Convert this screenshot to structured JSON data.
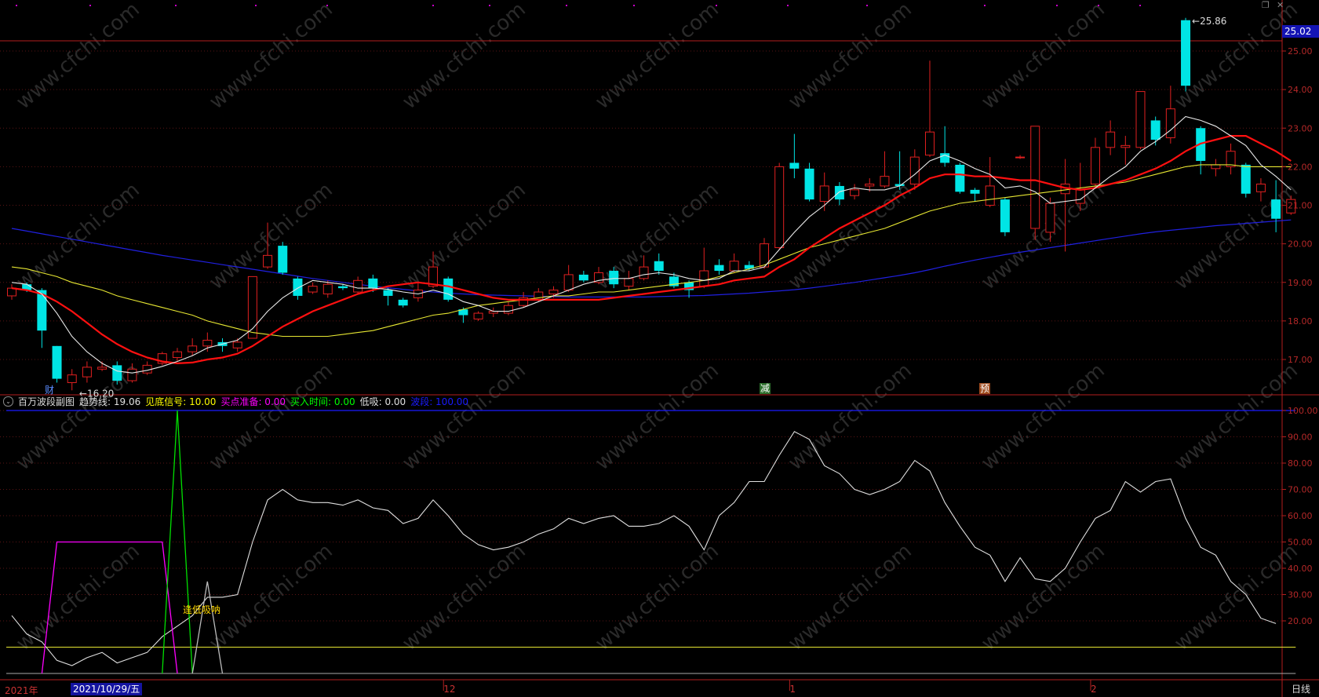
{
  "price_panel": {
    "price_tag": "25.02",
    "high_label": "25.86",
    "low_label": "16.20",
    "y_ticks": [
      "25.00",
      "24.00",
      "23.00",
      "22.00",
      "21.00",
      "20.00",
      "19.00",
      "18.00",
      "17.00"
    ],
    "event_marks": [
      "财",
      "减",
      "预"
    ]
  },
  "indicator": {
    "name": "百万波段副图",
    "fields": [
      {
        "label": "趋势线:",
        "value": "19.06",
        "color": "#e0e0e0"
      },
      {
        "label": "见底信号:",
        "value": "10.00",
        "color": "#ffff00"
      },
      {
        "label": "买点准备:",
        "value": "0.00",
        "color": "#ff00ff"
      },
      {
        "label": "买入时间:",
        "value": "0.00",
        "color": "#00ff00"
      },
      {
        "label": "低吸:",
        "value": "0.00",
        "color": "#e0e0e0"
      },
      {
        "label": "波段:",
        "value": "100.00",
        "color": "#1a1aff"
      }
    ],
    "annotation": "逢低吸呐",
    "y_ticks": [
      "100.00",
      "90.00",
      "80.00",
      "70.00",
      "60.00",
      "50.00",
      "40.00",
      "30.00",
      "20.00"
    ]
  },
  "x_axis": {
    "labels": [
      "2021年",
      "12",
      "1",
      "2"
    ],
    "cursor_date": "2021/10/29/五",
    "period": "日线"
  },
  "watermark": "www.cfchi.com",
  "colors": {
    "up": "#e02020",
    "down": "#00e5e5",
    "ma5": "#e8e8e8",
    "ma10": "#ff1010",
    "ma20": "#e6e632",
    "ma60": "#2020e0",
    "axis": "#b41e1e"
  },
  "chart_data": {
    "type": "candlestick",
    "candles": [
      {
        "o": 18.65,
        "c": 18.85,
        "h": 18.95,
        "l": 18.55
      },
      {
        "o": 18.95,
        "c": 18.8,
        "h": 19.0,
        "l": 18.75
      },
      {
        "o": 18.8,
        "c": 17.75,
        "h": 18.85,
        "l": 17.3
      },
      {
        "o": 17.35,
        "c": 16.5,
        "h": 17.35,
        "l": 16.4
      },
      {
        "o": 16.4,
        "c": 16.6,
        "h": 16.75,
        "l": 16.2
      },
      {
        "o": 16.55,
        "c": 16.8,
        "h": 16.95,
        "l": 16.4
      },
      {
        "o": 16.75,
        "c": 16.8,
        "h": 16.95,
        "l": 16.7
      },
      {
        "o": 16.85,
        "c": 16.45,
        "h": 16.95,
        "l": 16.35
      },
      {
        "o": 16.45,
        "c": 16.75,
        "h": 16.9,
        "l": 16.4
      },
      {
        "o": 16.65,
        "c": 16.85,
        "h": 16.95,
        "l": 16.6
      },
      {
        "o": 16.9,
        "c": 17.15,
        "h": 17.2,
        "l": 16.85
      },
      {
        "o": 17.05,
        "c": 17.2,
        "h": 17.3,
        "l": 16.95
      },
      {
        "o": 17.2,
        "c": 17.35,
        "h": 17.55,
        "l": 17.1
      },
      {
        "o": 17.35,
        "c": 17.5,
        "h": 17.7,
        "l": 17.2
      },
      {
        "o": 17.45,
        "c": 17.35,
        "h": 17.55,
        "l": 17.2
      },
      {
        "o": 17.3,
        "c": 17.45,
        "h": 17.55,
        "l": 17.2
      },
      {
        "o": 17.55,
        "c": 19.15,
        "h": 19.15,
        "l": 17.55
      },
      {
        "o": 19.4,
        "c": 19.7,
        "h": 20.55,
        "l": 19.35
      },
      {
        "o": 19.95,
        "c": 19.25,
        "h": 20.05,
        "l": 19.2
      },
      {
        "o": 19.1,
        "c": 18.65,
        "h": 19.15,
        "l": 18.55
      },
      {
        "o": 18.75,
        "c": 18.9,
        "h": 19.0,
        "l": 18.7
      },
      {
        "o": 18.7,
        "c": 18.95,
        "h": 19.05,
        "l": 18.6
      },
      {
        "o": 18.9,
        "c": 18.85,
        "h": 18.95,
        "l": 18.8
      },
      {
        "o": 18.75,
        "c": 19.05,
        "h": 19.15,
        "l": 18.7
      },
      {
        "o": 19.1,
        "c": 18.85,
        "h": 19.2,
        "l": 18.75
      },
      {
        "o": 18.8,
        "c": 18.65,
        "h": 18.85,
        "l": 18.4
      },
      {
        "o": 18.55,
        "c": 18.4,
        "h": 18.6,
        "l": 18.35
      },
      {
        "o": 18.6,
        "c": 18.8,
        "h": 19.0,
        "l": 18.5
      },
      {
        "o": 18.9,
        "c": 19.4,
        "h": 19.8,
        "l": 18.85
      },
      {
        "o": 19.1,
        "c": 18.55,
        "h": 19.15,
        "l": 18.5
      },
      {
        "o": 18.3,
        "c": 18.15,
        "h": 18.35,
        "l": 17.95
      },
      {
        "o": 18.05,
        "c": 18.2,
        "h": 18.25,
        "l": 18.0
      },
      {
        "o": 18.2,
        "c": 18.25,
        "h": 18.35,
        "l": 18.1
      },
      {
        "o": 18.2,
        "c": 18.4,
        "h": 18.5,
        "l": 18.15
      },
      {
        "o": 18.4,
        "c": 18.6,
        "h": 18.75,
        "l": 18.35
      },
      {
        "o": 18.55,
        "c": 18.75,
        "h": 18.85,
        "l": 18.5
      },
      {
        "o": 18.7,
        "c": 18.8,
        "h": 18.9,
        "l": 18.6
      },
      {
        "o": 18.8,
        "c": 19.2,
        "h": 19.45,
        "l": 18.75
      },
      {
        "o": 19.2,
        "c": 19.05,
        "h": 19.3,
        "l": 19.0
      },
      {
        "o": 19.0,
        "c": 19.25,
        "h": 19.4,
        "l": 18.95
      },
      {
        "o": 19.3,
        "c": 18.95,
        "h": 19.4,
        "l": 18.85
      },
      {
        "o": 18.9,
        "c": 19.1,
        "h": 19.3,
        "l": 18.8
      },
      {
        "o": 19.1,
        "c": 19.4,
        "h": 19.7,
        "l": 19.05
      },
      {
        "o": 19.55,
        "c": 19.3,
        "h": 19.75,
        "l": 19.2
      },
      {
        "o": 19.15,
        "c": 18.9,
        "h": 19.25,
        "l": 18.85
      },
      {
        "o": 19.0,
        "c": 18.8,
        "h": 19.05,
        "l": 18.6
      },
      {
        "o": 18.9,
        "c": 19.3,
        "h": 19.9,
        "l": 18.85
      },
      {
        "o": 19.45,
        "c": 19.3,
        "h": 19.6,
        "l": 19.2
      },
      {
        "o": 19.3,
        "c": 19.55,
        "h": 19.75,
        "l": 19.25
      },
      {
        "o": 19.45,
        "c": 19.35,
        "h": 19.55,
        "l": 19.3
      },
      {
        "o": 19.4,
        "c": 20.0,
        "h": 20.15,
        "l": 19.35
      },
      {
        "o": 19.9,
        "c": 22.0,
        "h": 22.1,
        "l": 19.85
      },
      {
        "o": 22.1,
        "c": 21.95,
        "h": 22.85,
        "l": 21.7
      },
      {
        "o": 21.95,
        "c": 21.15,
        "h": 22.1,
        "l": 21.1
      },
      {
        "o": 21.1,
        "c": 21.5,
        "h": 21.85,
        "l": 20.85
      },
      {
        "o": 21.5,
        "c": 21.15,
        "h": 21.6,
        "l": 21.0
      },
      {
        "o": 21.25,
        "c": 21.4,
        "h": 21.55,
        "l": 21.15
      },
      {
        "o": 21.5,
        "c": 21.55,
        "h": 21.7,
        "l": 21.35
      },
      {
        "o": 21.5,
        "c": 21.75,
        "h": 22.4,
        "l": 21.45
      },
      {
        "o": 21.55,
        "c": 21.5,
        "h": 22.4,
        "l": 21.4
      },
      {
        "o": 21.55,
        "c": 22.25,
        "h": 22.45,
        "l": 21.4
      },
      {
        "o": 22.3,
        "c": 22.9,
        "h": 24.75,
        "l": 22.25
      },
      {
        "o": 22.35,
        "c": 22.1,
        "h": 23.05,
        "l": 22.0
      },
      {
        "o": 22.05,
        "c": 21.35,
        "h": 22.1,
        "l": 21.3
      },
      {
        "o": 21.4,
        "c": 21.3,
        "h": 21.45,
        "l": 21.1
      },
      {
        "o": 21.0,
        "c": 21.5,
        "h": 22.25,
        "l": 20.95
      },
      {
        "o": 21.15,
        "c": 20.3,
        "h": 21.2,
        "l": 20.2
      },
      {
        "o": 22.25,
        "c": 22.25,
        "h": 22.3,
        "l": 22.2
      },
      {
        "o": 20.4,
        "c": 23.05,
        "h": 23.05,
        "l": 20.1
      },
      {
        "o": 20.3,
        "c": 21.05,
        "h": 21.2,
        "l": 20.05
      },
      {
        "o": 21.3,
        "c": 21.55,
        "h": 22.2,
        "l": 19.8
      },
      {
        "o": 21.05,
        "c": 21.4,
        "h": 22.1,
        "l": 20.85
      },
      {
        "o": 21.55,
        "c": 22.5,
        "h": 22.75,
        "l": 21.45
      },
      {
        "o": 22.5,
        "c": 22.9,
        "h": 23.2,
        "l": 22.3
      },
      {
        "o": 22.5,
        "c": 22.55,
        "h": 22.8,
        "l": 22.05
      },
      {
        "o": 22.5,
        "c": 23.95,
        "h": 23.95,
        "l": 22.45
      },
      {
        "o": 23.2,
        "c": 22.7,
        "h": 23.3,
        "l": 22.55
      },
      {
        "o": 22.75,
        "c": 23.5,
        "h": 24.1,
        "l": 22.6
      },
      {
        "o": 25.8,
        "c": 24.1,
        "h": 25.86,
        "l": 23.95
      },
      {
        "o": 23.0,
        "c": 22.15,
        "h": 23.05,
        "l": 21.8
      },
      {
        "o": 21.95,
        "c": 22.05,
        "h": 22.2,
        "l": 21.75
      },
      {
        "o": 22.0,
        "c": 22.4,
        "h": 22.6,
        "l": 21.8
      },
      {
        "o": 22.05,
        "c": 21.3,
        "h": 22.1,
        "l": 21.2
      },
      {
        "o": 21.35,
        "c": 21.55,
        "h": 21.7,
        "l": 21.1
      },
      {
        "o": 21.15,
        "c": 20.65,
        "h": 21.65,
        "l": 20.3
      },
      {
        "o": 20.8,
        "c": 21.15,
        "h": 21.25,
        "l": 20.75
      }
    ],
    "ma5": [
      19.0,
      18.95,
      18.7,
      18.2,
      17.6,
      17.2,
      16.9,
      16.7,
      16.65,
      16.72,
      16.82,
      16.95,
      17.1,
      17.3,
      17.4,
      17.5,
      17.8,
      18.25,
      18.6,
      18.85,
      19.05,
      19.0,
      18.95,
      18.85,
      18.85,
      18.82,
      18.75,
      18.7,
      18.8,
      18.7,
      18.5,
      18.4,
      18.25,
      18.25,
      18.35,
      18.5,
      18.65,
      18.8,
      18.95,
      19.05,
      19.1,
      19.1,
      19.2,
      19.25,
      19.2,
      19.1,
      19.05,
      19.1,
      19.3,
      19.3,
      19.4,
      19.85,
      20.3,
      20.7,
      21.0,
      21.35,
      21.45,
      21.4,
      21.4,
      21.5,
      21.8,
      22.15,
      22.3,
      22.15,
      21.95,
      21.8,
      21.45,
      21.5,
      21.35,
      21.05,
      21.1,
      21.15,
      21.45,
      21.75,
      22.0,
      22.4,
      22.65,
      22.95,
      23.3,
      23.2,
      23.05,
      22.8,
      22.55,
      22.05,
      21.75,
      21.4
    ],
    "ma10": [
      18.85,
      18.8,
      18.7,
      18.5,
      18.25,
      17.95,
      17.65,
      17.4,
      17.2,
      17.05,
      16.95,
      16.9,
      16.92,
      17.0,
      17.05,
      17.15,
      17.35,
      17.6,
      17.85,
      18.05,
      18.25,
      18.4,
      18.55,
      18.7,
      18.8,
      18.9,
      18.95,
      19.0,
      18.95,
      18.9,
      18.8,
      18.7,
      18.6,
      18.55,
      18.55,
      18.55,
      18.55,
      18.55,
      18.55,
      18.55,
      18.6,
      18.65,
      18.7,
      18.75,
      18.8,
      18.85,
      18.9,
      18.95,
      19.05,
      19.1,
      19.15,
      19.4,
      19.6,
      19.9,
      20.15,
      20.4,
      20.6,
      20.8,
      21.0,
      21.25,
      21.45,
      21.7,
      21.8,
      21.8,
      21.75,
      21.75,
      21.7,
      21.65,
      21.65,
      21.55,
      21.45,
      21.4,
      21.45,
      21.55,
      21.65,
      21.8,
      21.95,
      22.15,
      22.4,
      22.6,
      22.7,
      22.8,
      22.8,
      22.6,
      22.4,
      22.15
    ],
    "ma20": [
      19.4,
      19.35,
      19.25,
      19.15,
      19.0,
      18.9,
      18.8,
      18.65,
      18.55,
      18.45,
      18.35,
      18.25,
      18.15,
      18.0,
      17.9,
      17.8,
      17.7,
      17.65,
      17.6,
      17.6,
      17.6,
      17.6,
      17.65,
      17.7,
      17.75,
      17.85,
      17.95,
      18.05,
      18.15,
      18.2,
      18.3,
      18.4,
      18.45,
      18.5,
      18.55,
      18.6,
      18.65,
      18.65,
      18.7,
      18.75,
      18.75,
      18.8,
      18.85,
      18.9,
      18.95,
      19.0,
      19.05,
      19.15,
      19.25,
      19.35,
      19.45,
      19.6,
      19.75,
      19.9,
      20.0,
      20.1,
      20.2,
      20.3,
      20.4,
      20.55,
      20.7,
      20.85,
      20.95,
      21.05,
      21.1,
      21.15,
      21.2,
      21.25,
      21.3,
      21.35,
      21.4,
      21.45,
      21.5,
      21.55,
      21.6,
      21.7,
      21.8,
      21.9,
      22.0,
      22.05,
      22.05,
      22.05,
      22.0,
      22.0,
      22.0,
      22.0
    ],
    "ma60": [
      20.4,
      20.33,
      20.26,
      20.19,
      20.12,
      20.05,
      19.98,
      19.91,
      19.84,
      19.77,
      19.7,
      19.64,
      19.58,
      19.52,
      19.46,
      19.4,
      19.34,
      19.28,
      19.22,
      19.16,
      19.1,
      19.05,
      19.0,
      18.95,
      18.9,
      18.86,
      18.82,
      18.78,
      18.75,
      18.72,
      18.7,
      18.68,
      18.67,
      18.66,
      18.65,
      18.64,
      18.63,
      18.62,
      18.62,
      18.62,
      18.62,
      18.62,
      18.62,
      18.63,
      18.64,
      18.65,
      18.66,
      18.68,
      18.7,
      18.72,
      18.75,
      18.78,
      18.81,
      18.85,
      18.9,
      18.95,
      19.0,
      19.06,
      19.12,
      19.18,
      19.25,
      19.33,
      19.42,
      19.5,
      19.58,
      19.65,
      19.72,
      19.78,
      19.84,
      19.9,
      19.96,
      20.02,
      20.08,
      20.14,
      20.2,
      20.26,
      20.31,
      20.35,
      20.39,
      20.43,
      20.47,
      20.5,
      20.53,
      20.56,
      20.59,
      20.62
    ],
    "trend_line": [
      22,
      15,
      12,
      5,
      3,
      6,
      8,
      4,
      6,
      8,
      14,
      18,
      22,
      29,
      29,
      30,
      50,
      66,
      70,
      66,
      65,
      65,
      64,
      66,
      63,
      62,
      57,
      59,
      66,
      60,
      53,
      49,
      47,
      48,
      50,
      53,
      55,
      59,
      57,
      59,
      60,
      56,
      56,
      57,
      60,
      56,
      47,
      60,
      65,
      73,
      73,
      83,
      92,
      89,
      79,
      76,
      70,
      68,
      70,
      73,
      81,
      77,
      65,
      56,
      48,
      45,
      35,
      44,
      36,
      35,
      40,
      50,
      59,
      62,
      73,
      69,
      73,
      74,
      59,
      48,
      45,
      35,
      30,
      21,
      19
    ],
    "bottom_signal_level": 10,
    "purple_pulse": [
      {
        "i": 2,
        "v": 0
      },
      {
        "i": 3,
        "v": 50
      },
      {
        "i": 10,
        "v": 50
      },
      {
        "i": 11,
        "v": 0
      }
    ],
    "green_pulse": [
      {
        "i": 10,
        "v": 0
      },
      {
        "i": 11,
        "v": 100
      },
      {
        "i": 12,
        "v": 0
      }
    ],
    "gray_pulse": [
      {
        "i": 12,
        "v": 0
      },
      {
        "i": 13,
        "v": 35
      },
      {
        "i": 14,
        "v": 0
      }
    ],
    "band_level": 100,
    "x_label_index": {
      "12": 29,
      "1": 52,
      "2": 72
    }
  }
}
